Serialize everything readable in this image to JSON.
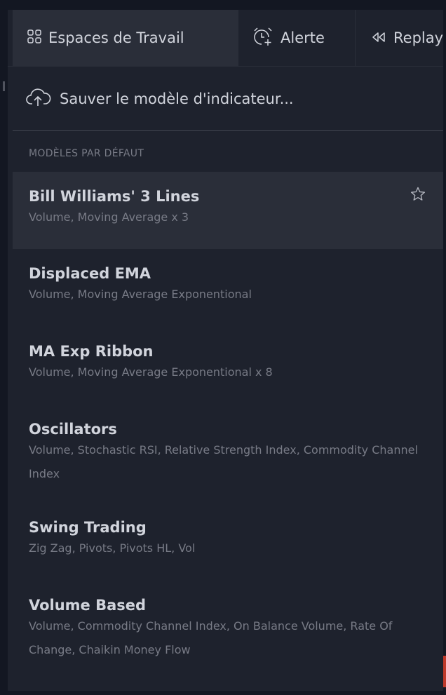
{
  "toolbar": {
    "workspaces_label": "Espaces de Travail",
    "alert_label": "Alerte",
    "replay_label": "Replay"
  },
  "menu": {
    "save_label": "Sauver le modèle d'indicateur...",
    "section_header": "MODÈLES PAR DÉFAUT",
    "templates": [
      {
        "name": "Bill Williams' 3 Lines",
        "desc": "Volume, Moving Average x 3"
      },
      {
        "name": "Displaced EMA",
        "desc": "Volume, Moving Average Exponentional"
      },
      {
        "name": "MA Exp Ribbon",
        "desc": "Volume, Moving Average Exponentional x 8"
      },
      {
        "name": "Oscillators",
        "desc": "Volume, Stochastic RSI, Relative Strength Index, Commodity Channel Index"
      },
      {
        "name": "Swing Trading",
        "desc": "Zig Zag, Pivots, Pivots HL, Vol"
      },
      {
        "name": "Volume Based",
        "desc": "Volume, Commodity Channel Index, On Balance Volume, Rate Of Change, Chaikin Money Flow"
      }
    ]
  },
  "icons": {
    "workspaces": "grid-icon",
    "alert": "alarm-clock-plus-icon",
    "replay": "rewind-icon",
    "save": "cloud-upload-icon",
    "favorite": "star-outline-icon"
  },
  "colors": {
    "background": "#1e222d",
    "hover": "#2a2e39",
    "text_primary": "#d1d4dc",
    "text_secondary": "#787b86"
  }
}
